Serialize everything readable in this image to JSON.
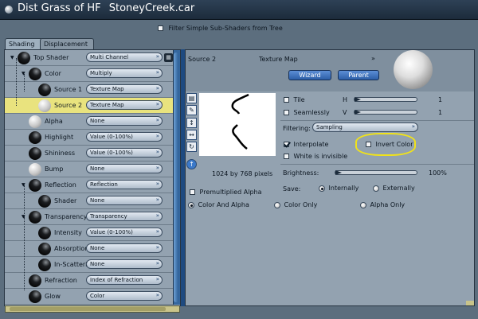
{
  "window": {
    "title": "Dist Grass of HF",
    "file": "StoneyCreek.car"
  },
  "filter": {
    "label": "Filter Simple Sub-Shaders from Tree",
    "checked": false
  },
  "tabs": [
    {
      "label": "Shading",
      "active": true
    },
    {
      "label": "Displacement",
      "active": false
    }
  ],
  "tree": [
    {
      "label": "Top Shader",
      "value": "Multi Channel",
      "ball": "black",
      "depth": 0
    },
    {
      "label": "Color",
      "value": "Multiply",
      "ball": "black",
      "depth": 1
    },
    {
      "label": "Source 1",
      "value": "Texture Map",
      "ball": "black",
      "depth": 2
    },
    {
      "label": "Source 2",
      "value": "Texture Map",
      "ball": "white",
      "depth": 2,
      "selected": true
    },
    {
      "label": "Alpha",
      "value": "None",
      "ball": "white",
      "depth": 1
    },
    {
      "label": "Highlight",
      "value": "Value (0-100%)",
      "ball": "black",
      "depth": 1
    },
    {
      "label": "Shininess",
      "value": "Value (0-100%)",
      "ball": "black",
      "depth": 1
    },
    {
      "label": "Bump",
      "value": "None",
      "ball": "white",
      "depth": 1
    },
    {
      "label": "Reflection",
      "value": "Reflection",
      "ball": "black",
      "depth": 1
    },
    {
      "label": "Shader",
      "value": "None",
      "ball": "black",
      "depth": 2
    },
    {
      "label": "Transparency",
      "value": "Transparency",
      "ball": "black",
      "depth": 1
    },
    {
      "label": "Intensity",
      "value": "Value (0-100%)",
      "ball": "black",
      "depth": 2
    },
    {
      "label": "Absorption",
      "value": "None",
      "ball": "black",
      "depth": 2
    },
    {
      "label": "In-Scattering",
      "value": "None",
      "ball": "black",
      "depth": 2
    },
    {
      "label": "Refraction",
      "value": "Index of Refraction",
      "ball": "black",
      "depth": 1
    },
    {
      "label": "Glow",
      "value": "Color",
      "ball": "black",
      "depth": 1
    }
  ],
  "detail": {
    "title": "Source 2",
    "type": "Texture Map",
    "wizard_label": "Wizard",
    "parent_label": "Parent",
    "tile_label": "Tile",
    "seamless_label": "Seamlessly",
    "h_label": "H",
    "v_label": "V",
    "h_value": "1",
    "v_value": "1",
    "filtering_label": "Filtering:",
    "filtering_value": "Sampling",
    "interpolate_label": "Interpolate",
    "interpolate_checked": true,
    "invert_label": "Invert Color",
    "invert_checked": false,
    "white_label": "White is invisible",
    "white_checked": false,
    "resolution": "1024 by 768 pixels",
    "premult_label": "Premultiplied Alpha",
    "premult_checked": false,
    "brightness_label": "Brightness:",
    "brightness_value": "100%",
    "save_label": "Save:",
    "internally_label": "Internally",
    "externally_label": "Externally",
    "save_mode": "Internally",
    "color_alpha_label": "Color And Alpha",
    "color_only_label": "Color Only",
    "alpha_only_label": "Alpha Only",
    "channel_mode": "Color And Alpha"
  },
  "icons": {
    "expand": "double-chevron-down-icon",
    "close": "close-dot-icon"
  },
  "colors": {
    "accent": "#2d5fa8",
    "selection": "#e9e37e",
    "panel": "#93a2b0",
    "highlight_ring": "#f0e21a"
  }
}
